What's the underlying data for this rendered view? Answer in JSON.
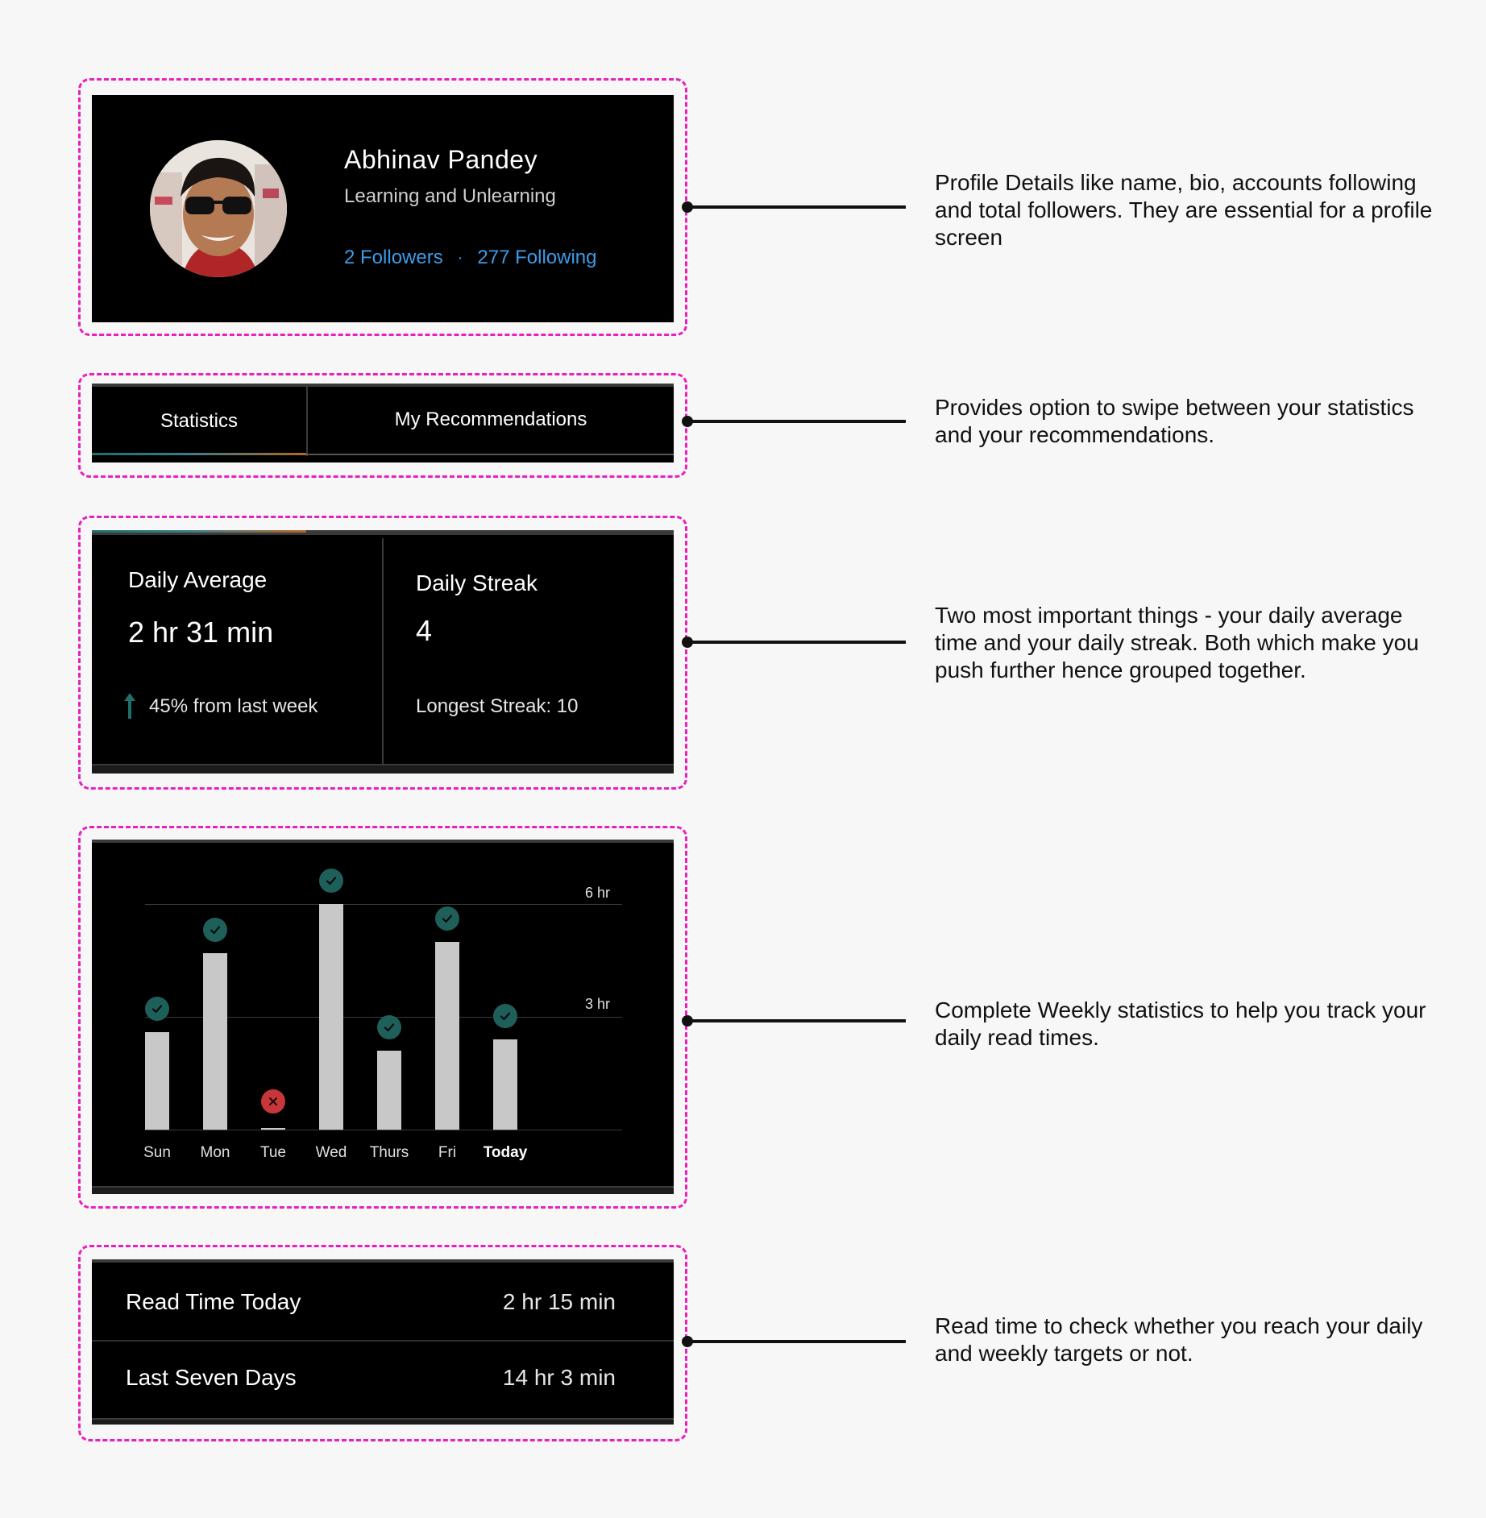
{
  "profile": {
    "name": "Abhinav Pandey",
    "bio": "Learning and Unlearning",
    "followers": "2 Followers",
    "separator": "·",
    "following": "277 Following"
  },
  "tabs": [
    {
      "label": "Statistics",
      "active": true
    },
    {
      "label": "My Recommendations",
      "active": false
    }
  ],
  "stats": {
    "daily_average": {
      "label": "Daily Average",
      "value": "2 hr 31 min",
      "change": "45% from last week"
    },
    "daily_streak": {
      "label": "Daily Streak",
      "value": "4",
      "longest": "Longest Streak: 10"
    }
  },
  "weekly": {
    "gridlines": [
      "6 hr",
      "3 hr"
    ]
  },
  "chart_data": {
    "type": "bar",
    "categories": [
      "Sun",
      "Mon",
      "Tue",
      "Wed",
      "Thurs",
      "Fri",
      "Today"
    ],
    "values": [
      2.6,
      4.7,
      0.05,
      6.0,
      2.1,
      5.0,
      2.4
    ],
    "status": [
      "done",
      "done",
      "missed",
      "done",
      "done",
      "done",
      "done"
    ],
    "ylim": [
      0,
      6
    ],
    "y_ticks": [
      "3 hr",
      "6 hr"
    ]
  },
  "read_time": [
    {
      "label": "Read Time Today",
      "value": "2 hr 15 min"
    },
    {
      "label": "Last Seven Days",
      "value": "14 hr 3 min"
    }
  ],
  "annotations": [
    "Profile Details like name, bio, accounts following and total followers. They are essential for a profile screen",
    "Provides option to swipe between your statistics and your recommendations.",
    "Two most important things - your daily average time and your daily streak. Both which make you push further hence grouped together.",
    "Complete Weekly statistics to help you track your daily read times.",
    "Read time to check whether you reach your daily and weekly targets or not."
  ],
  "colors": {
    "frame": "#e91fc0",
    "panel": "#000000",
    "link": "#3d9be9",
    "check_badge": "#1f5f5a",
    "miss_badge": "#c8363a",
    "bar": "#c8c8c8"
  }
}
